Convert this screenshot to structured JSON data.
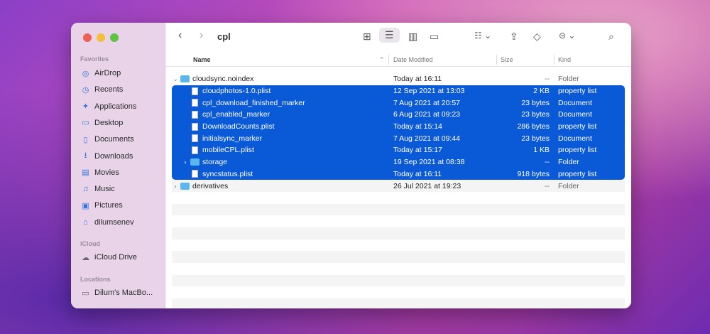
{
  "window": {
    "title": "cpl"
  },
  "sidebar": {
    "favorites_label": "Favorites",
    "favorites": [
      {
        "label": "AirDrop",
        "icon": "airdrop-icon"
      },
      {
        "label": "Recents",
        "icon": "clock-icon"
      },
      {
        "label": "Applications",
        "icon": "applications-icon"
      },
      {
        "label": "Desktop",
        "icon": "desktop-icon"
      },
      {
        "label": "Documents",
        "icon": "document-icon"
      },
      {
        "label": "Downloads",
        "icon": "download-icon"
      },
      {
        "label": "Movies",
        "icon": "film-icon"
      },
      {
        "label": "Music",
        "icon": "music-icon"
      },
      {
        "label": "Pictures",
        "icon": "photo-icon"
      },
      {
        "label": "dilumsenev",
        "icon": "home-icon"
      }
    ],
    "icloud_label": "iCloud",
    "icloud": [
      {
        "label": "iCloud Drive",
        "icon": "cloud-icon"
      }
    ],
    "locations_label": "Locations",
    "locations": [
      {
        "label": "Dilum's MacBo...",
        "icon": "laptop-icon"
      }
    ]
  },
  "columns": {
    "name": "Name",
    "date": "Date Modified",
    "size": "Size",
    "kind": "Kind"
  },
  "rows": [
    {
      "name": "cloudsync.noindex",
      "date": "Today at 16:11",
      "size": "--",
      "kind": "Folder",
      "type": "folder",
      "expanded": true,
      "level": 0,
      "selected": false
    },
    {
      "name": "cloudphotos-1.0.plist",
      "date": "12 Sep 2021 at 13:03",
      "size": "2 KB",
      "kind": "property list",
      "type": "file",
      "level": 1,
      "selected": true
    },
    {
      "name": "cpl_download_finished_marker",
      "date": "7 Aug 2021 at 20:57",
      "size": "23 bytes",
      "kind": "Document",
      "type": "file",
      "level": 1,
      "selected": true
    },
    {
      "name": "cpl_enabled_marker",
      "date": "6 Aug 2021 at 09:23",
      "size": "23 bytes",
      "kind": "Document",
      "type": "file",
      "level": 1,
      "selected": true
    },
    {
      "name": "DownloadCounts.plist",
      "date": "Today at 15:14",
      "size": "286 bytes",
      "kind": "property list",
      "type": "file",
      "level": 1,
      "selected": true
    },
    {
      "name": "initialsync_marker",
      "date": "7 Aug 2021 at 09:44",
      "size": "23 bytes",
      "kind": "Document",
      "type": "file",
      "level": 1,
      "selected": true
    },
    {
      "name": "mobileCPL.plist",
      "date": "Today at 15:17",
      "size": "1 KB",
      "kind": "property list",
      "type": "file",
      "level": 1,
      "selected": true
    },
    {
      "name": "storage",
      "date": "19 Sep 2021 at 08:38",
      "size": "--",
      "kind": "Folder",
      "type": "folder",
      "expanded": false,
      "level": 1,
      "selected": true
    },
    {
      "name": "syncstatus.plist",
      "date": "Today at 16:11",
      "size": "918 bytes",
      "kind": "property list",
      "type": "file",
      "level": 1,
      "selected": true
    },
    {
      "name": "derivatives",
      "date": "26 Jul 2021 at 19:23",
      "size": "--",
      "kind": "Folder",
      "type": "folder",
      "expanded": false,
      "level": 0,
      "selected": false
    }
  ]
}
